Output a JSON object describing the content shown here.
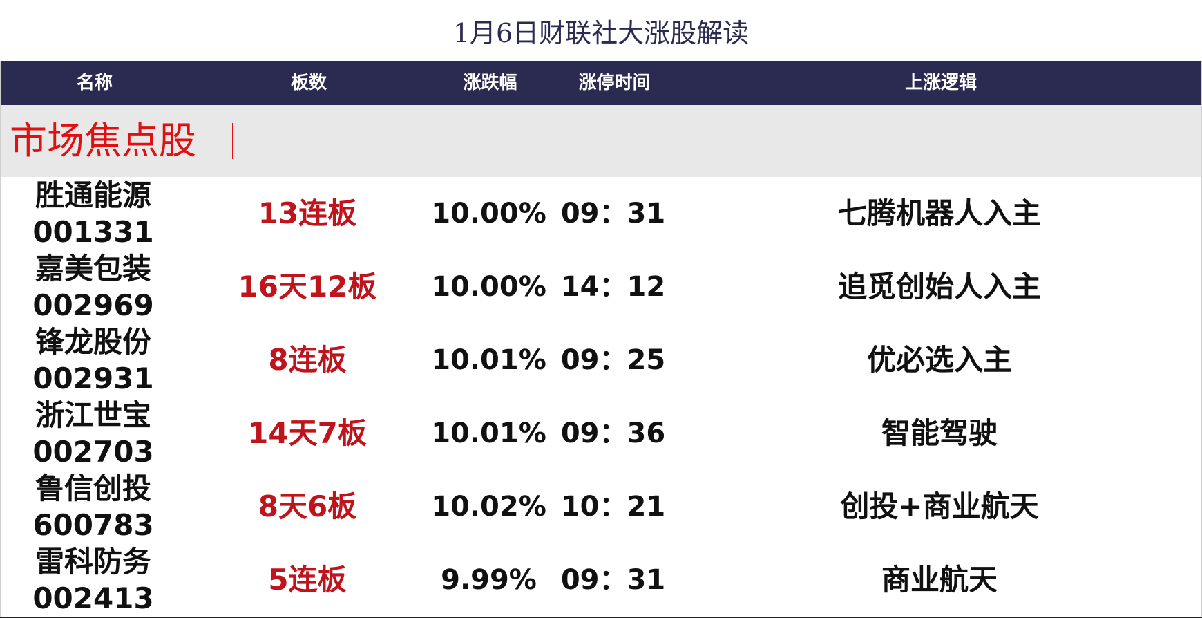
{
  "title": "1月6日财联社大涨股解读",
  "header": {
    "name": "名称",
    "board": "板数",
    "change": "涨跌幅",
    "limit_time": "涨停时间",
    "logic": "上涨逻辑"
  },
  "section": {
    "label": "市场焦点股"
  },
  "rows": [
    {
      "name": "胜通能源",
      "code": "001331",
      "board": "13连板",
      "change": "10.00%",
      "time": "09：31",
      "logic": "七腾机器人入主"
    },
    {
      "name": "嘉美包装",
      "code": "002969",
      "board": "16天12板",
      "change": "10.00%",
      "time": "14：12",
      "logic": "追觅创始人入主"
    },
    {
      "name": "锋龙股份",
      "code": "002931",
      "board": "8连板",
      "change": "10.01%",
      "time": "09：25",
      "logic": "优必选入主"
    },
    {
      "name": "浙江世宝",
      "code": "002703",
      "board": "14天7板",
      "change": "10.01%",
      "time": "09：36",
      "logic": "智能驾驶"
    },
    {
      "name": "鲁信创投",
      "code": "600783",
      "board": "8天6板",
      "change": "10.02%",
      "time": "10：21",
      "logic": "创投+商业航天"
    },
    {
      "name": "雷科防务",
      "code": "002413",
      "board": "5连板",
      "change": "9.99%",
      "time": "09：31",
      "logic": "商业航天"
    }
  ]
}
